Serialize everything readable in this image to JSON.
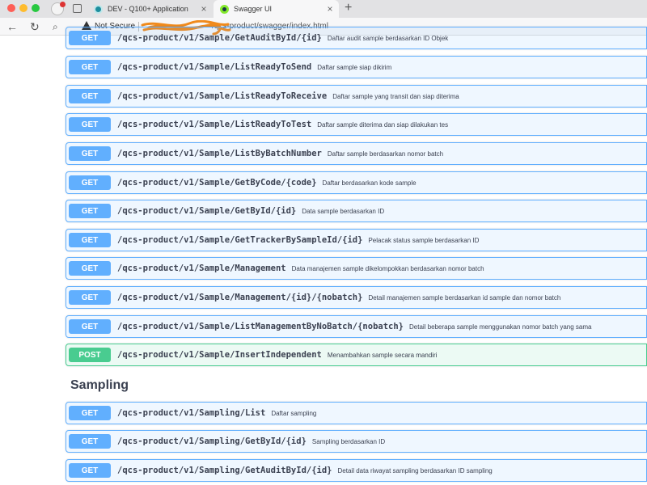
{
  "browser": {
    "tabs": [
      {
        "label": "DEV - Q100+ Application",
        "close": "×",
        "favicon": "dev-favicon"
      },
      {
        "label": "Swagger UI",
        "close": "×",
        "favicon": "swagger-favicon"
      }
    ],
    "new_tab": "+",
    "security_label": "Not Secure",
    "url_visible": "/qcs-product/swagger/index.html",
    "icons": {
      "back": "←",
      "reload": "↻",
      "search": "⌕"
    }
  },
  "operations_top": [
    {
      "method": "GET",
      "path": "/qcs-product/v1/Sample/GetAuditById/{id}",
      "desc": "Daftar audit sample berdasarkan ID Objek"
    },
    {
      "method": "GET",
      "path": "/qcs-product/v1/Sample/ListReadyToSend",
      "desc": "Daftar sample siap dikirim"
    },
    {
      "method": "GET",
      "path": "/qcs-product/v1/Sample/ListReadyToReceive",
      "desc": "Daftar sample yang transit dan siap diterima"
    },
    {
      "method": "GET",
      "path": "/qcs-product/v1/Sample/ListReadyToTest",
      "desc": "Daftar sample diterima dan siap dilakukan tes"
    },
    {
      "method": "GET",
      "path": "/qcs-product/v1/Sample/ListByBatchNumber",
      "desc": "Daftar sample berdasarkan nomor batch"
    },
    {
      "method": "GET",
      "path": "/qcs-product/v1/Sample/GetByCode/{code}",
      "desc": "Daftar berdasarkan kode sample"
    },
    {
      "method": "GET",
      "path": "/qcs-product/v1/Sample/GetById/{id}",
      "desc": "Data sample berdasarkan ID"
    },
    {
      "method": "GET",
      "path": "/qcs-product/v1/Sample/GetTrackerBySampleId/{id}",
      "desc": "Pelacak status sample berdasarkan ID"
    },
    {
      "method": "GET",
      "path": "/qcs-product/v1/Sample/Management",
      "desc": "Data manajemen sample dikelompokkan berdasarkan nomor batch"
    },
    {
      "method": "GET",
      "path": "/qcs-product/v1/Sample/Management/{id}/{nobatch}",
      "desc": "Detail manajemen sample berdasarkan id sample dan nomor batch"
    },
    {
      "method": "GET",
      "path": "/qcs-product/v1/Sample/ListManagementByNoBatch/{nobatch}",
      "desc": "Detail beberapa sample menggunakan nomor batch yang sama"
    },
    {
      "method": "POST",
      "path": "/qcs-product/v1/Sample/InsertIndependent",
      "desc": "Menambahkan sample secara mandiri"
    }
  ],
  "section_title": "Sampling",
  "operations_sampling": [
    {
      "method": "GET",
      "path": "/qcs-product/v1/Sampling/List",
      "desc": "Daftar sampling"
    },
    {
      "method": "GET",
      "path": "/qcs-product/v1/Sampling/GetById/{id}",
      "desc": "Sampling berdasarkan ID"
    },
    {
      "method": "GET",
      "path": "/qcs-product/v1/Sampling/GetAuditById/{id}",
      "desc": "Detail data riwayat sampling berdasarkan ID sampling"
    }
  ],
  "colors": {
    "get": "#61affe",
    "post": "#49cc90",
    "text": "#3b4151"
  }
}
